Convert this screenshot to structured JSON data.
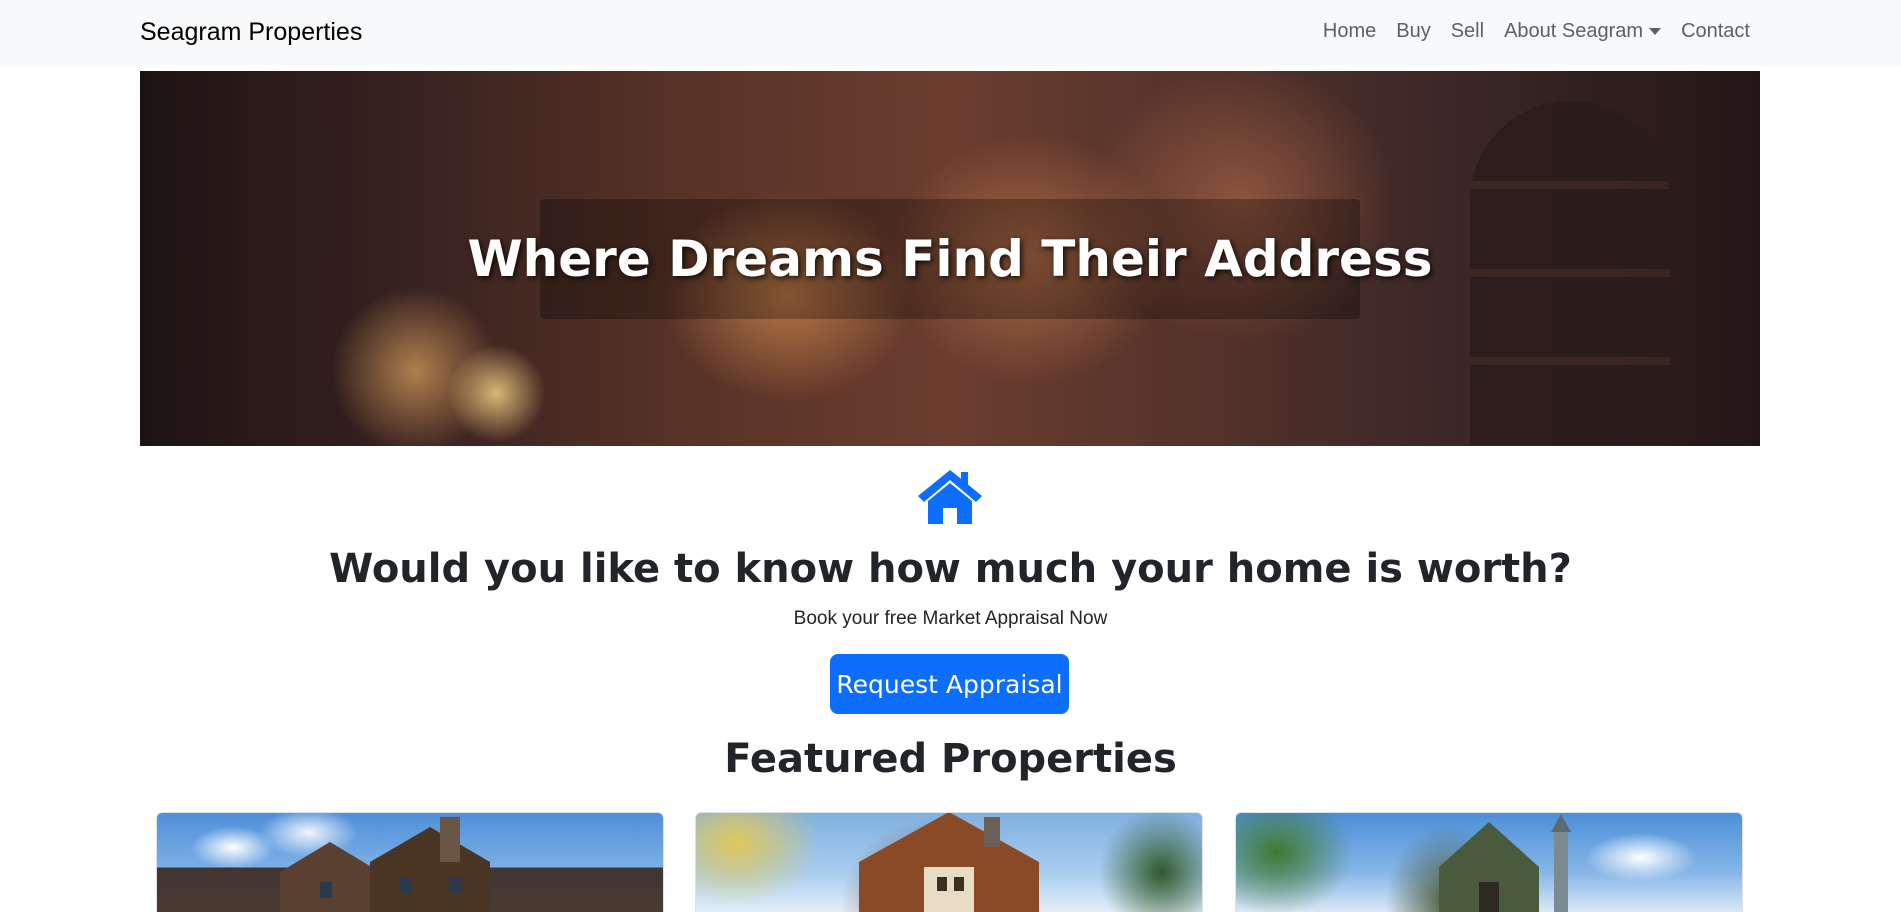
{
  "navbar": {
    "brand": "Seagram Properties",
    "links": [
      "Home",
      "Buy",
      "Sell",
      "About Seagram",
      "Contact"
    ]
  },
  "hero": {
    "title": "Where Dreams Find Their Address"
  },
  "appraisal": {
    "icon": "home-icon",
    "heading": "Would you like to know how much your home is worth?",
    "subtext": "Book your free Market Appraisal Now",
    "button_label": "Request Appraisal"
  },
  "featured": {
    "heading": "Featured Properties"
  },
  "colors": {
    "primary": "#0d6efd",
    "navbar_bg": "#f8f9fa",
    "text": "#212529"
  }
}
